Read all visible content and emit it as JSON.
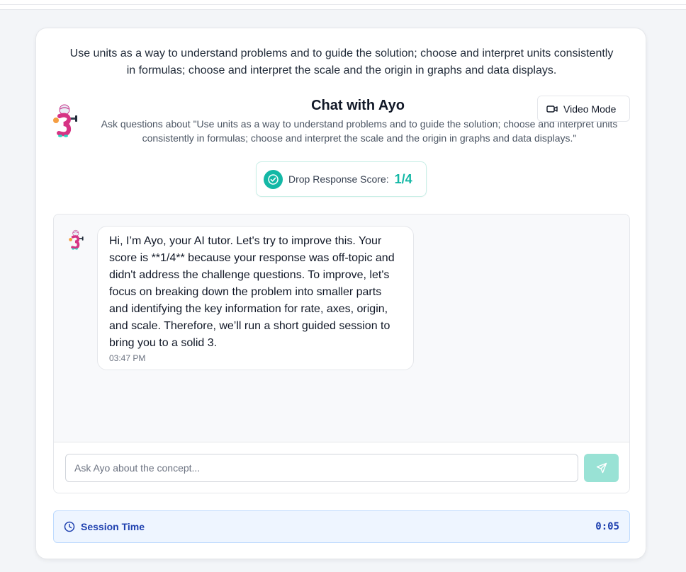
{
  "standard": {
    "text": "Use units as a way to understand problems and to guide the solution; choose and interpret units consistently in formulas; choose and interpret the scale and the origin in graphs and data displays."
  },
  "chat_header": {
    "title": "Chat with Ayo",
    "subtitle": "Ask questions about \"Use units as a way to understand problems and to guide the solution; choose and interpret units consistently in formulas; choose and interpret the scale and the origin in graphs and data displays.\"",
    "avatar_icon": "ayo-mascot-icon"
  },
  "video_mode": {
    "label": "Video Mode",
    "icon": "video-camera-icon"
  },
  "score": {
    "label": "Drop Response Score:",
    "value": "1/4",
    "icon": "check-circle-icon",
    "accent_color": "#14b8a6"
  },
  "messages": [
    {
      "sender": "Ayo",
      "text": "Hi, I’m Ayo, your AI tutor. Let's try to improve this. Your score is **1/4** because your response was off-topic and didn't address the challenge questions. To improve, let's focus on breaking down the problem into smaller parts and identifying the key information for rate, axes, origin, and scale. Therefore, we’ll run a short guided session to bring you to a solid 3.",
      "time": "03:47 PM"
    }
  ],
  "chat_input": {
    "placeholder": "Ask Ayo about the concept...",
    "value": "",
    "send_icon": "send-icon"
  },
  "session": {
    "label": "Session Time",
    "time": "0:05",
    "icon": "clock-icon",
    "color": "#1e40af"
  }
}
